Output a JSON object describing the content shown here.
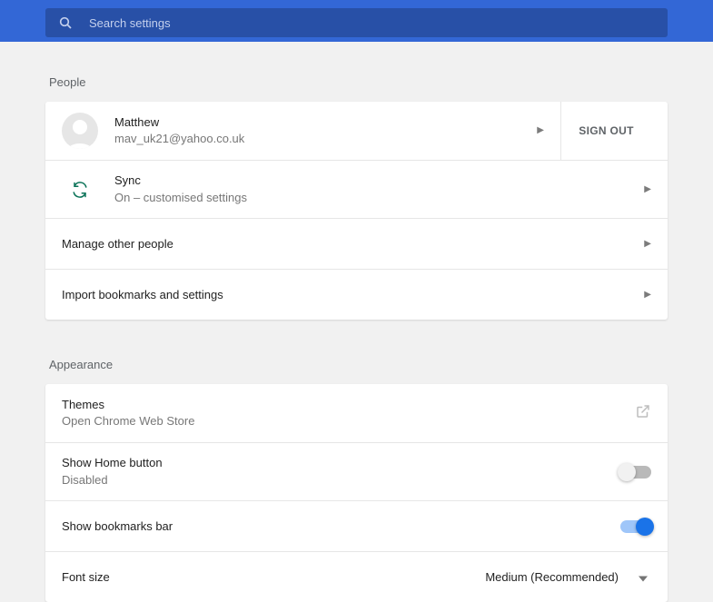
{
  "search": {
    "placeholder": "Search settings"
  },
  "sections": {
    "people": {
      "title": "People",
      "profile": {
        "name": "Matthew",
        "email": "mav_uk21@yahoo.co.uk",
        "signout": "SIGN OUT"
      },
      "sync": {
        "title": "Sync",
        "subtitle": "On – customised settings"
      },
      "manage_other_people": {
        "title": "Manage other people"
      },
      "import": {
        "title": "Import bookmarks and settings"
      }
    },
    "appearance": {
      "title": "Appearance",
      "themes": {
        "title": "Themes",
        "subtitle": "Open Chrome Web Store"
      },
      "home_button": {
        "title": "Show Home button",
        "subtitle": "Disabled",
        "enabled": false
      },
      "bookmarks_bar": {
        "title": "Show bookmarks bar",
        "enabled": true
      },
      "font_size": {
        "title": "Font size",
        "value": "Medium (Recommended)"
      }
    }
  }
}
